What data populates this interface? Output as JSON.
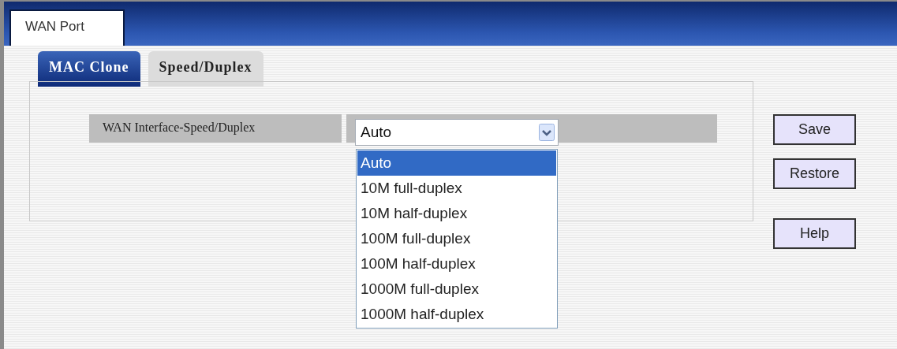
{
  "page_tab": {
    "label": "WAN Port"
  },
  "tabs": [
    {
      "label": "MAC Clone",
      "selected": true
    },
    {
      "label": "Speed/Duplex",
      "selected": false
    }
  ],
  "form": {
    "label": "WAN Interface-Speed/Duplex",
    "value": "Auto",
    "expanded": true,
    "options": [
      {
        "label": "Auto",
        "selected": true
      },
      {
        "label": "10M full-duplex",
        "selected": false
      },
      {
        "label": "10M half-duplex",
        "selected": false
      },
      {
        "label": "100M full-duplex",
        "selected": false
      },
      {
        "label": "100M half-duplex",
        "selected": false
      },
      {
        "label": "1000M full-duplex",
        "selected": false
      },
      {
        "label": "1000M half-duplex",
        "selected": false
      }
    ]
  },
  "buttons": [
    "Save",
    "Restore",
    "Help"
  ]
}
